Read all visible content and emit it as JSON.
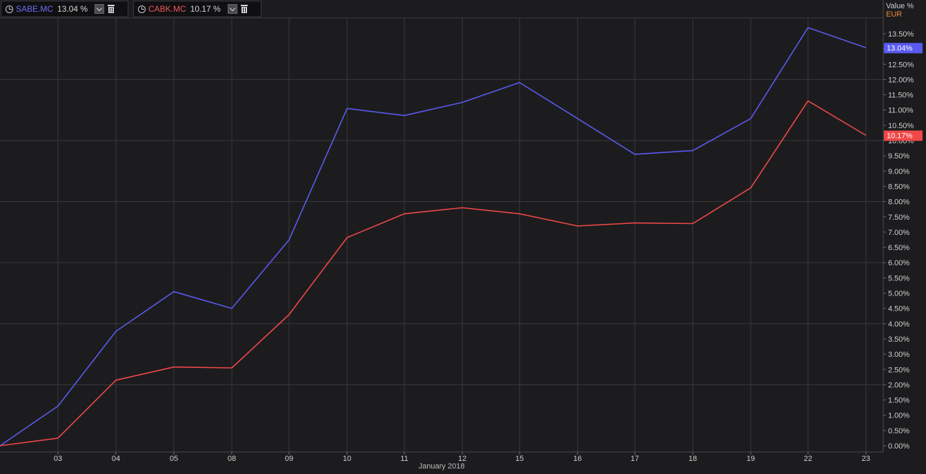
{
  "legend": [
    {
      "name": "SABE.MC",
      "value": "13.04 %",
      "color": "#5a5af0"
    },
    {
      "name": "CABK.MC",
      "value": "10.17 %",
      "color": "#f04848"
    }
  ],
  "axis": {
    "title": "Value %",
    "unit": "EUR"
  },
  "x_caption": "January 2018",
  "badges": {
    "sabe": "13.04%",
    "cabk": "10.17%"
  },
  "colors": {
    "background": "#1c1c1e",
    "grid": "#3a3a3e",
    "sabe": "#5a5af0",
    "cabk": "#f04848"
  },
  "icons": [
    "clock-icon",
    "chevron-down-icon",
    "trash-icon"
  ],
  "chart_data": {
    "type": "line",
    "categories": [
      "",
      "03",
      "04",
      "05",
      "08",
      "09",
      "10",
      "11",
      "12",
      "15",
      "16",
      "17",
      "18",
      "19",
      "22",
      "23"
    ],
    "series": [
      {
        "name": "SABE.MC",
        "values": [
          0.0,
          1.3,
          3.75,
          5.05,
          4.5,
          6.75,
          11.05,
          10.82,
          11.25,
          11.9,
          10.72,
          9.55,
          9.67,
          10.72,
          13.7,
          13.04
        ]
      },
      {
        "name": "CABK.MC",
        "values": [
          0.0,
          0.25,
          2.15,
          2.58,
          2.55,
          4.3,
          6.82,
          7.6,
          7.8,
          7.6,
          7.2,
          7.3,
          7.28,
          8.45,
          11.3,
          10.17
        ]
      }
    ],
    "y_ticks": [
      "0.00%",
      "0.50%",
      "1.00%",
      "1.50%",
      "2.00%",
      "2.50%",
      "3.00%",
      "3.50%",
      "4.00%",
      "4.50%",
      "5.00%",
      "5.50%",
      "6.00%",
      "6.50%",
      "7.00%",
      "7.50%",
      "8.00%",
      "8.50%",
      "9.00%",
      "9.50%",
      "10.00%",
      "10.50%",
      "11.00%",
      "11.50%",
      "12.00%",
      "12.50%",
      "13.00%",
      "13.50%"
    ],
    "ylim": [
      0,
      14
    ],
    "xlabel": "January 2018",
    "ylabel": "Value %",
    "grid": true,
    "legend_position": "top-left"
  }
}
